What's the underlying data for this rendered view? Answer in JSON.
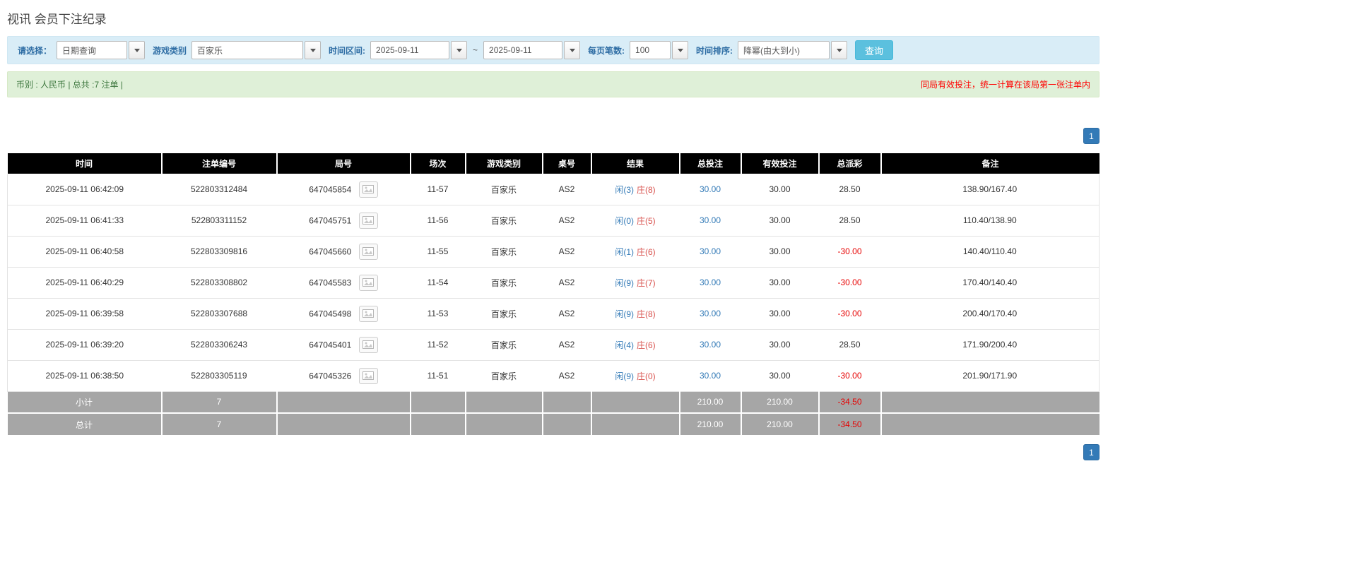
{
  "page": {
    "title": "视讯 会员下注纪录"
  },
  "filters": {
    "select_label": "请选择：",
    "select_value": "日期查询",
    "game_type_label": "游戏类别",
    "game_type_value": "百家乐",
    "date_range_label": "时间区间:",
    "date_from": "2025-09-11",
    "date_separator": "~",
    "date_to": "2025-09-11",
    "page_size_label": "每页笔数:",
    "page_size_value": "100",
    "sort_label": "时间排序:",
    "sort_value": "降幂(由大到小)",
    "search_button": "查询"
  },
  "summary": {
    "left": "币别 : 人民币 | 总共 :7 注单 |",
    "right": "同局有效投注，统一计算在该局第一张注单内"
  },
  "pagination": {
    "page": "1"
  },
  "table": {
    "headers": [
      "时间",
      "注单编号",
      "局号",
      "场次",
      "游戏类别",
      "桌号",
      "结果",
      "总投注",
      "有效投注",
      "总派彩",
      "备注"
    ],
    "rows": [
      {
        "time": "2025-09-11 06:42:09",
        "bet_id": "522803312484",
        "round_no": "647045854",
        "session": "11-57",
        "game_type": "百家乐",
        "table_no": "AS2",
        "result_player": "闲(3)",
        "result_banker": "庄(8)",
        "total_bet": "30.00",
        "valid_bet": "30.00",
        "payout": "28.50",
        "remark": "138.90/167.40"
      },
      {
        "time": "2025-09-11 06:41:33",
        "bet_id": "522803311152",
        "round_no": "647045751",
        "session": "11-56",
        "game_type": "百家乐",
        "table_no": "AS2",
        "result_player": "闲(0)",
        "result_banker": "庄(5)",
        "total_bet": "30.00",
        "valid_bet": "30.00",
        "payout": "28.50",
        "remark": "110.40/138.90"
      },
      {
        "time": "2025-09-11 06:40:58",
        "bet_id": "522803309816",
        "round_no": "647045660",
        "session": "11-55",
        "game_type": "百家乐",
        "table_no": "AS2",
        "result_player": "闲(1)",
        "result_banker": "庄(6)",
        "total_bet": "30.00",
        "valid_bet": "30.00",
        "payout": "-30.00",
        "remark": "140.40/110.40"
      },
      {
        "time": "2025-09-11 06:40:29",
        "bet_id": "522803308802",
        "round_no": "647045583",
        "session": "11-54",
        "game_type": "百家乐",
        "table_no": "AS2",
        "result_player": "闲(9)",
        "result_banker": "庄(7)",
        "total_bet": "30.00",
        "valid_bet": "30.00",
        "payout": "-30.00",
        "remark": "170.40/140.40"
      },
      {
        "time": "2025-09-11 06:39:58",
        "bet_id": "522803307688",
        "round_no": "647045498",
        "session": "11-53",
        "game_type": "百家乐",
        "table_no": "AS2",
        "result_player": "闲(9)",
        "result_banker": "庄(8)",
        "total_bet": "30.00",
        "valid_bet": "30.00",
        "payout": "-30.00",
        "remark": "200.40/170.40"
      },
      {
        "time": "2025-09-11 06:39:20",
        "bet_id": "522803306243",
        "round_no": "647045401",
        "session": "11-52",
        "game_type": "百家乐",
        "table_no": "AS2",
        "result_player": "闲(4)",
        "result_banker": "庄(6)",
        "total_bet": "30.00",
        "valid_bet": "30.00",
        "payout": "28.50",
        "remark": "171.90/200.40"
      },
      {
        "time": "2025-09-11 06:38:50",
        "bet_id": "522803305119",
        "round_no": "647045326",
        "session": "11-51",
        "game_type": "百家乐",
        "table_no": "AS2",
        "result_player": "闲(9)",
        "result_banker": "庄(0)",
        "total_bet": "30.00",
        "valid_bet": "30.00",
        "payout": "-30.00",
        "remark": "201.90/171.90"
      }
    ],
    "subtotal": {
      "label": "小计",
      "count": "7",
      "total_bet": "210.00",
      "valid_bet": "210.00",
      "payout": "-34.50"
    },
    "total": {
      "label": "总计",
      "count": "7",
      "total_bet": "210.00",
      "valid_bet": "210.00",
      "payout": "-34.50"
    }
  }
}
